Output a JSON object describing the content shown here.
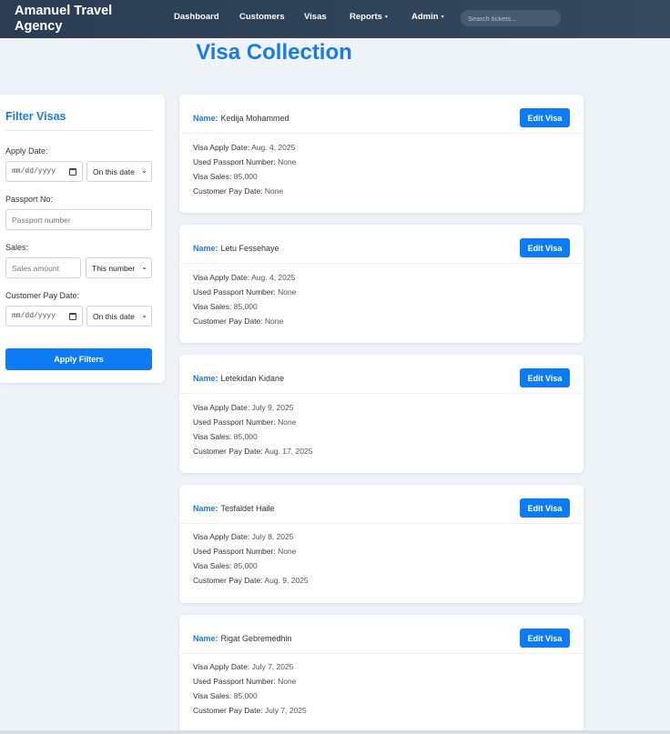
{
  "navbar": {
    "brand": "Amanuel Travel Agency",
    "links": [
      "Dashboard",
      "Customers",
      "Visas",
      "Reports",
      "Admin"
    ],
    "dropdown_arrow": "▾",
    "search_placeholder": "Search tickets..."
  },
  "page_title": "Visa Collection",
  "filter": {
    "title": "Filter Visas",
    "apply_date_label": "Apply Date:",
    "apply_date_placeholder": "mm/dd/yyyy",
    "apply_date_mode": "On this date",
    "passport_label": "Passport No:",
    "passport_placeholder": "Passport number",
    "sales_label": "Sales:",
    "sales_placeholder": "Sales amount",
    "sales_mode": "This number",
    "pay_date_label": "Customer Pay Date:",
    "pay_date_placeholder": "mm/dd/yyyy",
    "pay_date_mode": "On this date",
    "apply_button": "Apply Filters"
  },
  "card_labels": {
    "name": "Name:",
    "apply_date": "Visa Apply Date:",
    "passport": "Used Passport Number:",
    "sales": "Visa Sales:",
    "pay_date": "Customer Pay Date:",
    "edit": "Edit Visa"
  },
  "visas": [
    {
      "name": "Kedija Mohammed",
      "apply_date": "Aug. 4, 2025",
      "passport": "None",
      "sales": "85,000",
      "pay_date": "None"
    },
    {
      "name": "Letu Fessehaye",
      "apply_date": "Aug. 4, 2025",
      "passport": "None",
      "sales": "85,000",
      "pay_date": "None"
    },
    {
      "name": "Letekidan Kidane",
      "apply_date": "July 9, 2025",
      "passport": "None",
      "sales": "85,000",
      "pay_date": "Aug. 17, 2025"
    },
    {
      "name": "Tesfaldet Haile",
      "apply_date": "July 8, 2025",
      "passport": "None",
      "sales": "85,000",
      "pay_date": "Aug. 9, 2025"
    },
    {
      "name": "Rigat Gebremedhin",
      "apply_date": "July 7, 2025",
      "passport": "None",
      "sales": "85,000",
      "pay_date": "July 7, 2025"
    }
  ],
  "colors": {
    "accent": "#1a7be6",
    "button": "#0d7bf5",
    "navbar": "#2f4359"
  }
}
